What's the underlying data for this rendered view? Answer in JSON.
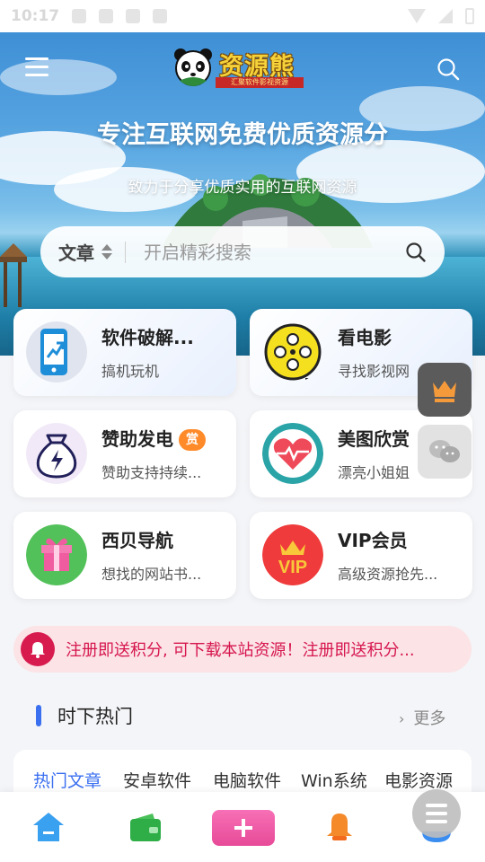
{
  "status_bar": {
    "time": "10:17"
  },
  "header": {
    "logo_text": "资源熊",
    "logo_sub": "汇聚软件影视资源",
    "title": "专注互联网免费优质资源分",
    "subtitle": "致力于分享优质实用的互联网资源"
  },
  "search": {
    "category": "文章",
    "placeholder": "开启精彩搜索"
  },
  "cards": [
    {
      "title": "软件破解...",
      "desc": "搞机玩机"
    },
    {
      "title": "看电影",
      "desc": "寻找影视网"
    },
    {
      "title": "赞助发电",
      "badge": "赏",
      "desc": "赞助支持持续..."
    },
    {
      "title": "美图欣赏",
      "desc": "漂亮小姐姐"
    },
    {
      "title": "西贝导航",
      "desc": "想找的网站书..."
    },
    {
      "title": "VIP会员",
      "desc": "高级资源抢先..."
    }
  ],
  "notice": {
    "text": "注册即送积分, 可下载本站资源！注册即送积分..."
  },
  "section": {
    "title": "时下热门",
    "more": "更多"
  },
  "tabs": [
    "热门文章",
    "安卓软件",
    "电脑软件",
    "Win系统",
    "电影资源"
  ],
  "icons": {
    "menu": "menu-icon",
    "search": "search-icon",
    "card_1": "phone-upgrade-icon",
    "card_2": "film-reel-icon",
    "card_3": "money-bag-icon",
    "card_4": "heart-pulse-icon",
    "card_5": "gift-icon",
    "card_6": "vip-crown-icon",
    "float_1": "crown-icon",
    "float_2": "wechat-icon",
    "notice": "bell-icon",
    "nav": [
      "home-icon",
      "wallet-icon",
      "add-icon",
      "notification-icon",
      "profile-icon"
    ]
  },
  "colors": {
    "accent": "#3a6ff0",
    "notice": "#d6164d",
    "badge": "#ff8a2a",
    "add_button": "#ef5aa3"
  }
}
